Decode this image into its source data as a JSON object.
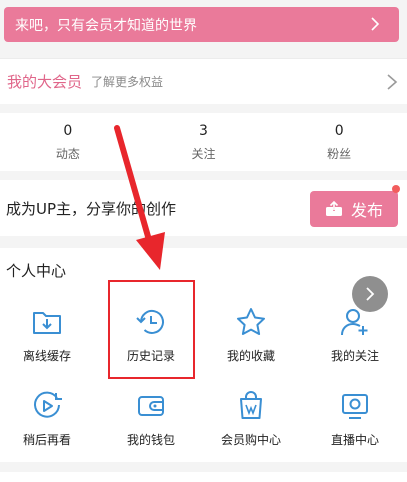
{
  "vip_banner": {
    "text": "来吧，只有会员才知道的世界"
  },
  "member": {
    "title": "我的大会员",
    "subtitle": "了解更多权益"
  },
  "stats": [
    {
      "value": "0",
      "label": "动态"
    },
    {
      "value": "3",
      "label": "关注"
    },
    {
      "value": "0",
      "label": "粉丝"
    }
  ],
  "up_promo": {
    "text": "成为UP主，分享你的创作",
    "publish_label": "发布"
  },
  "personal_center": {
    "title": "个人中心",
    "items": [
      {
        "label": "离线缓存",
        "icon": "download-folder-icon"
      },
      {
        "label": "历史记录",
        "icon": "history-clock-icon"
      },
      {
        "label": "我的收藏",
        "icon": "star-icon"
      },
      {
        "label": "我的关注",
        "icon": "user-add-icon"
      },
      {
        "label": "稍后再看",
        "icon": "play-later-icon"
      },
      {
        "label": "我的钱包",
        "icon": "wallet-icon"
      },
      {
        "label": "会员购中心",
        "icon": "shopping-bag-icon"
      },
      {
        "label": "直播中心",
        "icon": "live-tv-icon"
      }
    ]
  },
  "colors": {
    "accent": "#ea7a9a",
    "icon_blue": "#3a8fd3",
    "highlight": "#e8262c"
  }
}
